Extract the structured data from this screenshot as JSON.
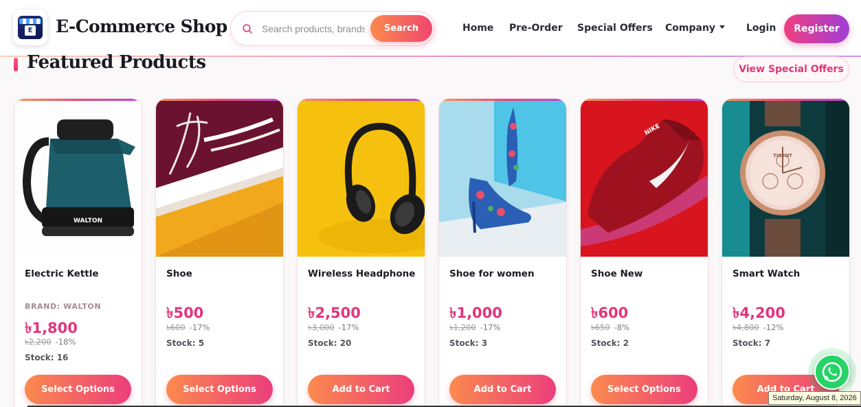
{
  "brand": {
    "name": "E-Commerce Shop",
    "logo_letter": "E"
  },
  "search": {
    "placeholder": "Search products, brands...",
    "button_label": "Search"
  },
  "nav": {
    "home": "Home",
    "preorder": "Pre-Order",
    "special": "Special Offers",
    "company": "Company",
    "login": "Login",
    "register": "Register"
  },
  "section": {
    "title": "Featured Products",
    "view_offers": "View Special Offers"
  },
  "products": [
    {
      "name": "Electric Kettle",
      "brand": "BRAND: WALTON",
      "price": "৳1,800",
      "old_price": "৳2,200",
      "discount": "-18%",
      "stock": "Stock: 16",
      "cta": "Select Options",
      "image_text": "WALTON"
    },
    {
      "name": "Shoe",
      "price": "৳500",
      "old_price": "৳600",
      "discount": "-17%",
      "stock": "Stock: 5",
      "cta": "Select Options"
    },
    {
      "name": "Wireless Headphone",
      "price": "৳2,500",
      "old_price": "৳3,000",
      "discount": "-17%",
      "stock": "Stock: 20",
      "cta": "Add to Cart"
    },
    {
      "name": "Shoe for women",
      "price": "৳1,000",
      "old_price": "৳1,200",
      "discount": "-17%",
      "stock": "Stock: 3",
      "cta": "Add to Cart"
    },
    {
      "name": "Shoe New",
      "price": "৳600",
      "old_price": "৳650",
      "discount": "-8%",
      "stock": "Stock: 2",
      "cta": "Select Options",
      "image_text": "NIKE"
    },
    {
      "name": "Smart Watch",
      "price": "৳4,200",
      "old_price": "৳4,800",
      "discount": "-12%",
      "stock": "Stock: 7",
      "cta": "Add to Cart",
      "image_text": "TISSOT"
    }
  ],
  "tooltip": "Saturday, August 8, 2026",
  "colors": {
    "accent_pink": "#e2357b",
    "accent_orange": "#fb8a4e",
    "accent_purple": "#a13ed6",
    "whatsapp": "#25d366"
  }
}
